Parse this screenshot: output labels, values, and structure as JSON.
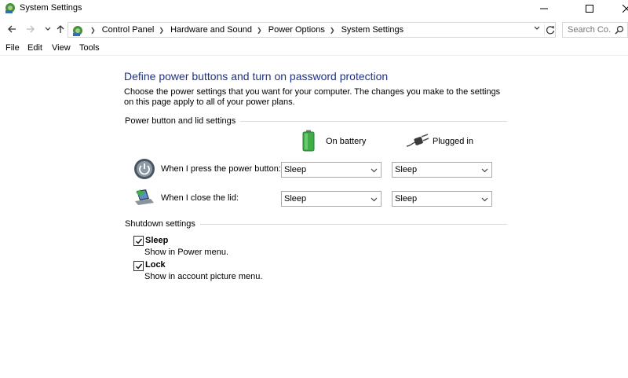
{
  "window": {
    "title": "System Settings",
    "app_icon": "control-panel-icon"
  },
  "nav": {
    "back_icon": "back-arrow-icon",
    "forward_icon": "forward-arrow-icon",
    "recent_icon": "chevron-down-icon",
    "up_icon": "up-arrow-icon",
    "breadcrumbs": [
      "Control Panel",
      "Hardware and Sound",
      "Power Options",
      "System Settings"
    ],
    "search_placeholder": "Search Co..."
  },
  "menu": [
    "File",
    "Edit",
    "View",
    "Tools"
  ],
  "main": {
    "heading": "Define power buttons and turn on password protection",
    "description": "Choose the power settings that you want for your computer. The changes you make to the settings on this page apply to all of your power plans.",
    "power_group": {
      "label": "Power button and lid settings",
      "columns": [
        {
          "label": "On battery",
          "icon": "battery-icon"
        },
        {
          "label": "Plugged in",
          "icon": "power-plug-icon"
        }
      ],
      "rows": [
        {
          "label": "When I press the power button:",
          "icon": "power-button-icon",
          "on_battery": "Sleep",
          "plugged_in": "Sleep"
        },
        {
          "label": "When I close the lid:",
          "icon": "laptop-lid-icon",
          "on_battery": "Sleep",
          "plugged_in": "Sleep"
        }
      ]
    },
    "shutdown_group": {
      "label": "Shutdown settings",
      "items": [
        {
          "label": "Sleep",
          "sub": "Show in Power menu.",
          "checked": true
        },
        {
          "label": "Lock",
          "sub": "Show in account picture menu.",
          "checked": true
        }
      ]
    }
  },
  "colors": {
    "heading": "#1e3287",
    "battery_green": "#3fae49"
  }
}
